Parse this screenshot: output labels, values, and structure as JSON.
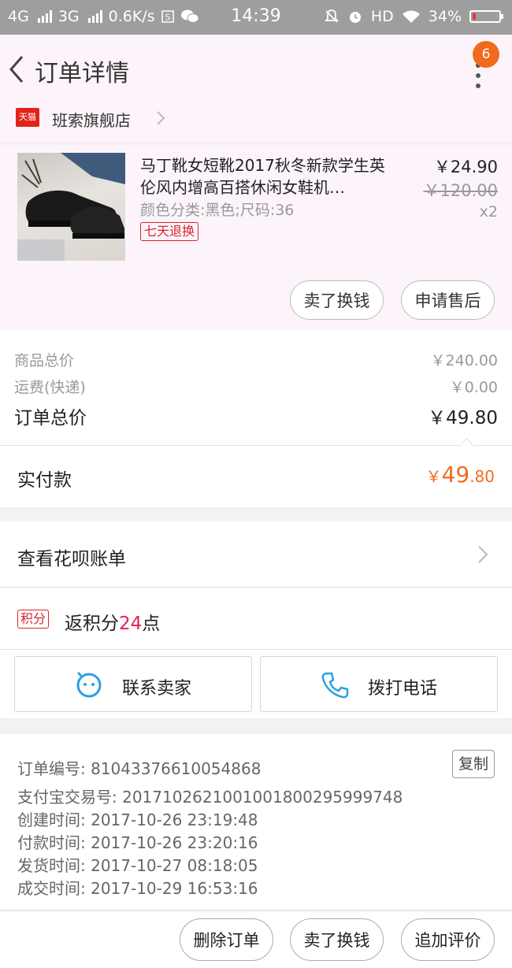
{
  "status_bar": {
    "network_4g": "4G",
    "network_3g": "3G",
    "speed": "0.6K/s",
    "time": "14:39",
    "hd": "HD",
    "battery": "34%"
  },
  "nav": {
    "title": "订单详情",
    "badge_count": "6"
  },
  "shop": {
    "tag": "天猫",
    "name": "班索旗舰店"
  },
  "product": {
    "title": "马丁靴女短靴2017秋冬新款学生英伦风内增高百搭休闲女鞋机…",
    "spec": "颜色分类:黑色;尺码:36",
    "tag": "七天退换",
    "price": "￥24.90",
    "original_price": "￥120.00",
    "quantity": "x2",
    "btn_resell": "卖了换钱",
    "btn_after_sale": "申请售后"
  },
  "summary": {
    "goods_label": "商品总价",
    "goods_value": "￥240.00",
    "shipping_label": "运费(快递)",
    "shipping_value": "￥0.00",
    "total_label": "订单总价",
    "total_value": "￥49.80"
  },
  "paid": {
    "label": "实付款",
    "currency": "￥",
    "integer": "49",
    "decimal": ".80"
  },
  "huabei": {
    "label": "查看花呗账单"
  },
  "points": {
    "tag": "积分",
    "prefix": "返积分",
    "count": "24",
    "suffix": "点"
  },
  "contact": {
    "seller": "联系卖家",
    "phone": "拨打电话"
  },
  "order_info": {
    "copy_label": "复制",
    "rows": [
      "订单编号: 81043376610054868",
      "支付宝交易号: 2017102621001001800295999748",
      "创建时间: 2017-10-26 23:19:48",
      "付款时间: 2017-10-26 23:20:16",
      "发货时间: 2017-10-27 08:18:05",
      "成交时间: 2017-10-29 16:53:16"
    ]
  },
  "bottom": {
    "delete": "删除订单",
    "resell": "卖了换钱",
    "review": "追加评价"
  },
  "colors": {
    "accent": "#f36a1c",
    "tmall_red": "#e2231a",
    "points_red": "#e3224e"
  }
}
